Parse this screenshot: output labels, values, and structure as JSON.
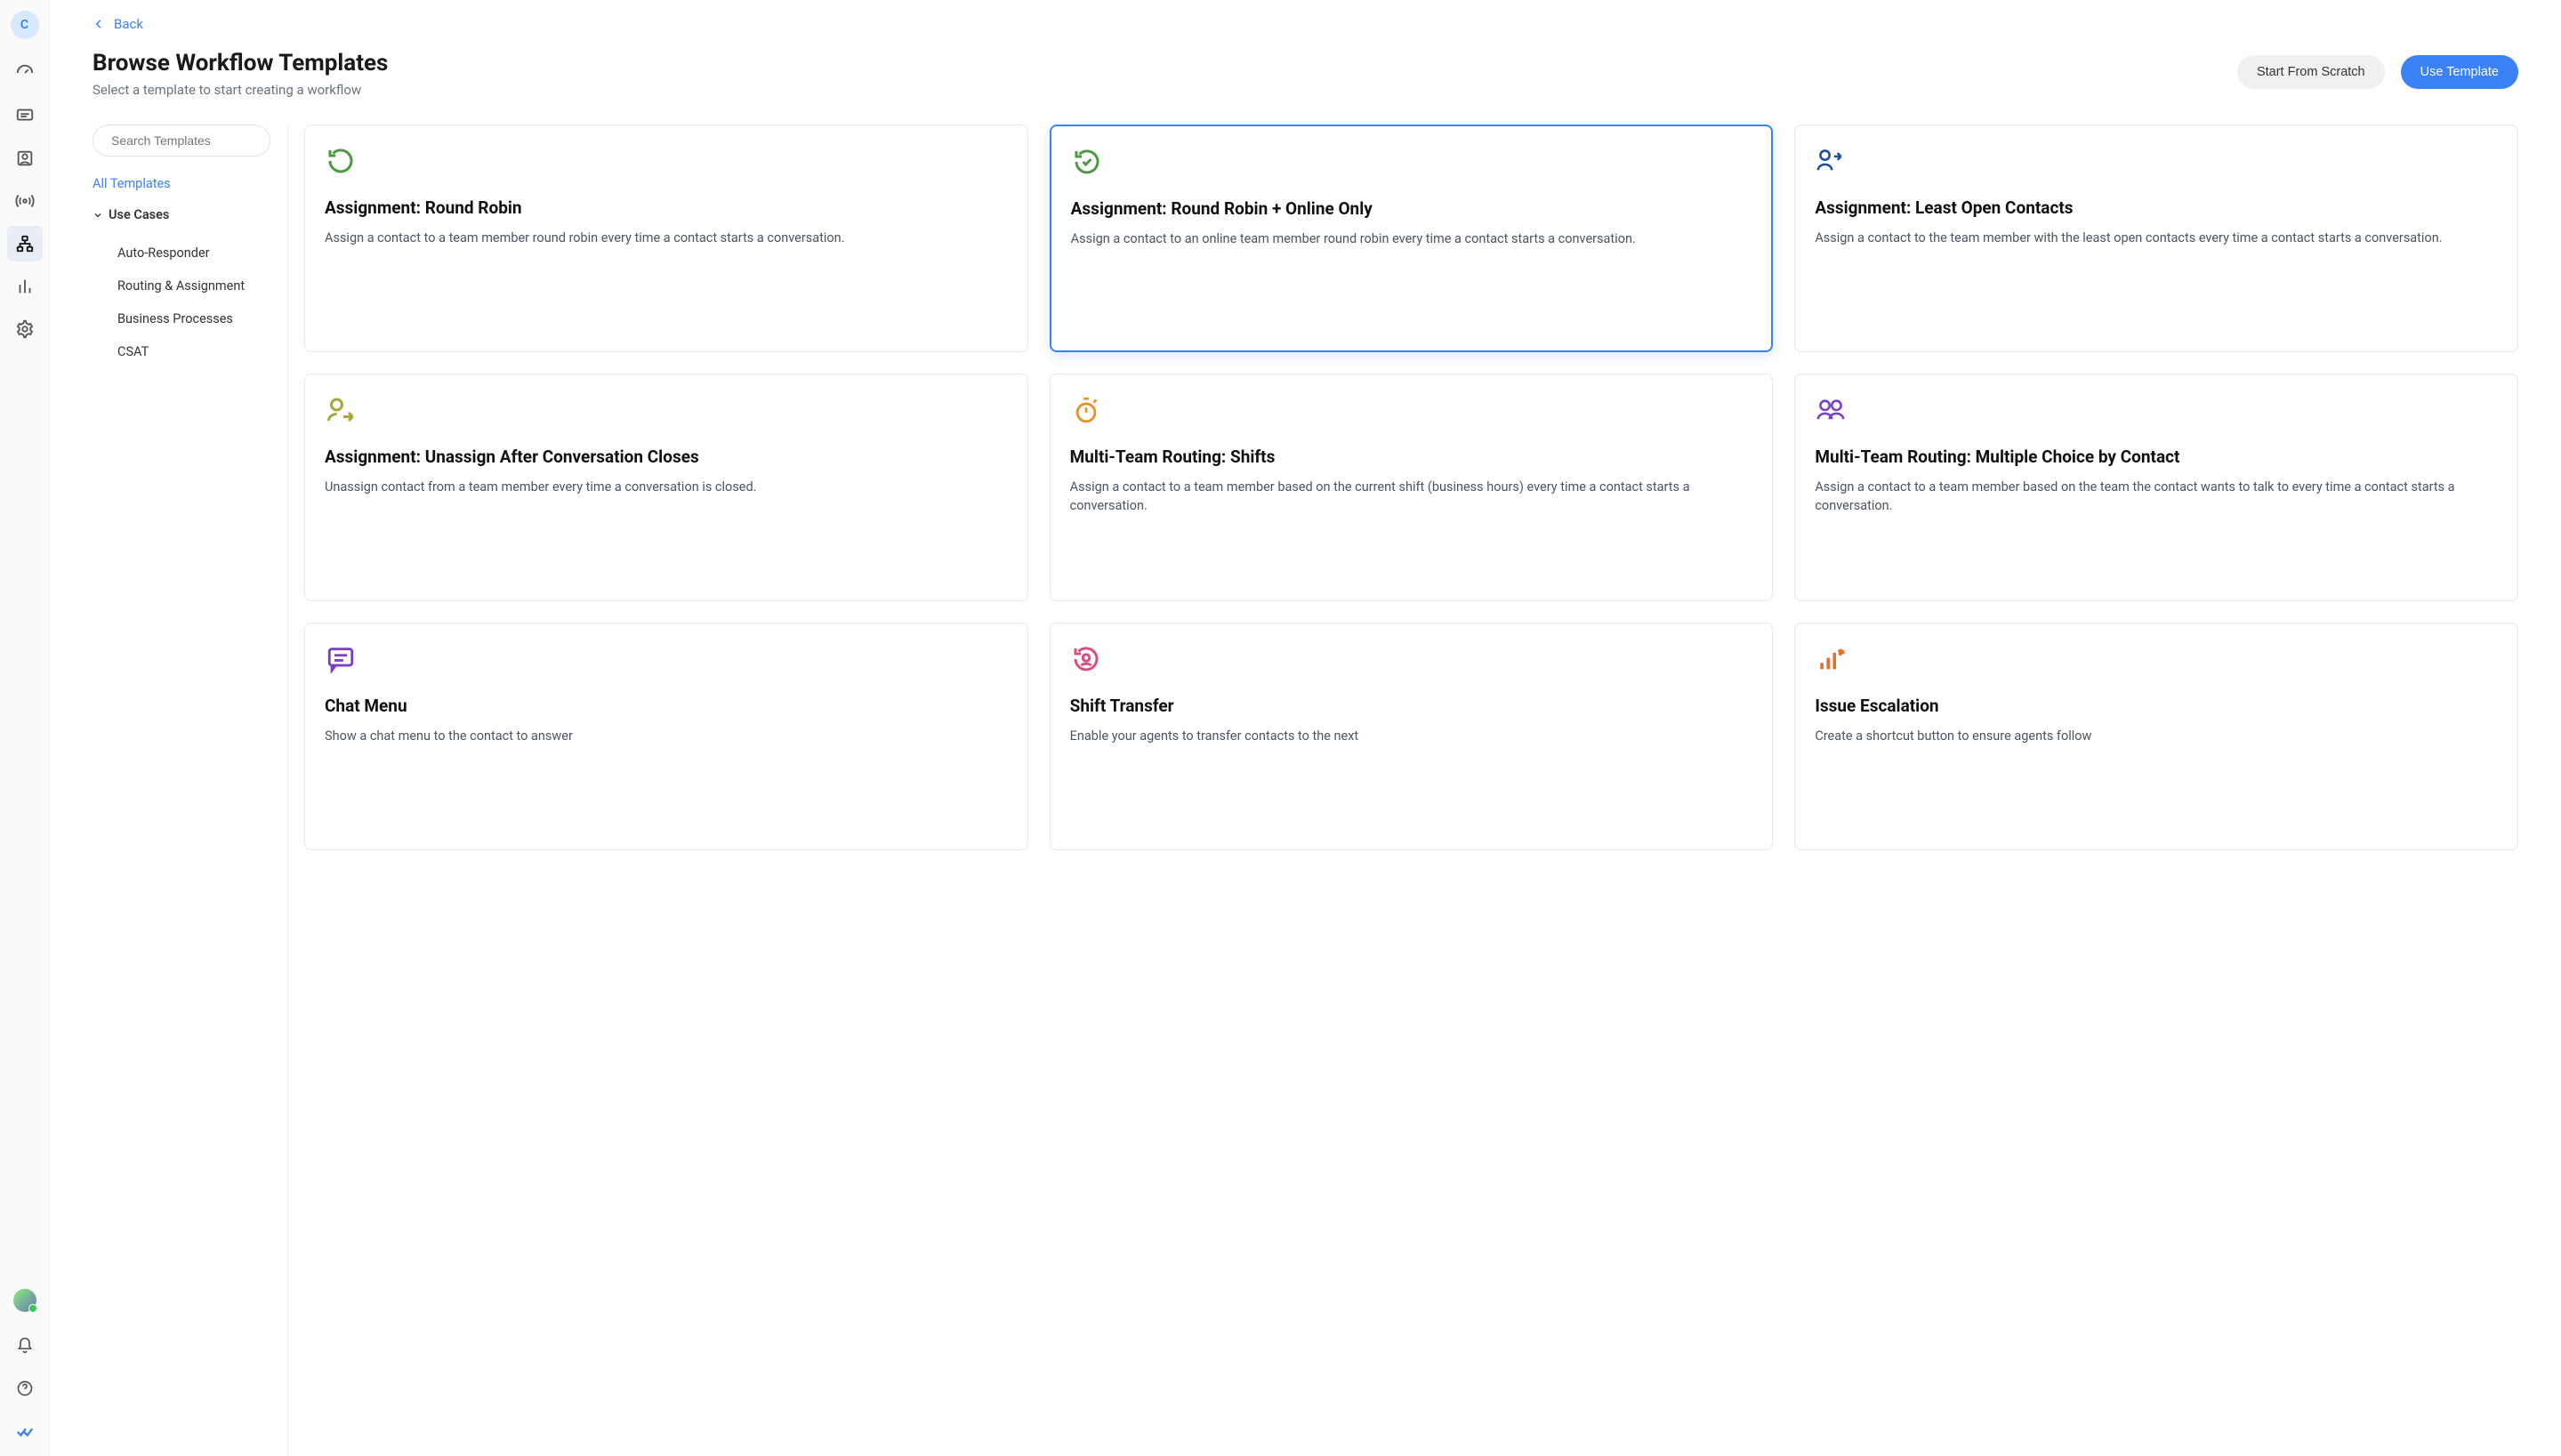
{
  "rail": {
    "avatar_initial": "C"
  },
  "header": {
    "back_label": "Back",
    "title": "Browse Workflow Templates",
    "subtitle": "Select a template to start creating a workflow",
    "start_scratch_label": "Start From Scratch",
    "use_template_label": "Use Template"
  },
  "sidebar": {
    "search_placeholder": "Search Templates",
    "all_templates_label": "All Templates",
    "group_label": "Use Cases",
    "items": [
      "Auto-Responder",
      "Routing & Assignment",
      "Business Processes",
      "CSAT"
    ]
  },
  "templates": [
    {
      "title": "Assignment: Round Robin",
      "desc": "Assign a contact to a team member round robin every time a contact starts a conversation.",
      "icon": "reset-green",
      "selected": false
    },
    {
      "title": "Assignment: Round Robin + Online Only",
      "desc": "Assign a contact to an online team member round robin every time a contact starts a conversation.",
      "icon": "reset-check-green",
      "selected": true
    },
    {
      "title": "Assignment: Least Open Contacts",
      "desc": "Assign a contact to the team member with the least open contacts every time a contact starts a conversation.",
      "icon": "person-share-blue",
      "selected": false
    },
    {
      "title": "Assignment: Unassign After Conversation Closes",
      "desc": "Unassign contact from a team member every time a conversation is closed.",
      "icon": "person-arrow-olive",
      "selected": false
    },
    {
      "title": "Multi-Team Routing: Shifts",
      "desc": "Assign a contact to a team member based on the current shift (business hours) every time a contact starts a conversation.",
      "icon": "stopwatch-orange",
      "selected": false
    },
    {
      "title": "Multi-Team Routing: Multiple Choice by Contact",
      "desc": "Assign a contact to a team member based on the team the contact wants to talk to every time a contact starts a conversation.",
      "icon": "people-purple",
      "selected": false
    },
    {
      "title": "Chat Menu",
      "desc": "Show a chat menu to the contact to answer",
      "icon": "chat-purple",
      "selected": false
    },
    {
      "title": "Shift Transfer",
      "desc": "Enable your agents to transfer contacts to the next",
      "icon": "reset-person-pink",
      "selected": false
    },
    {
      "title": "Issue Escalation",
      "desc": "Create a shortcut button to ensure agents follow",
      "icon": "bars-orange",
      "selected": false
    }
  ]
}
